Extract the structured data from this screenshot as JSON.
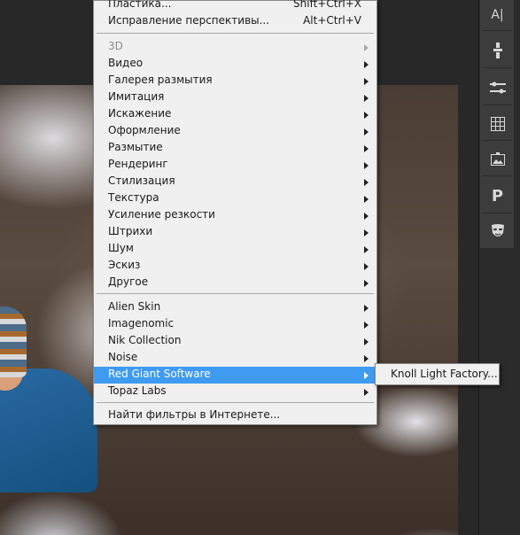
{
  "filter_menu": {
    "top_items": [
      {
        "label": "Пластика...",
        "shortcut": "Shift+Ctrl+X"
      },
      {
        "label": "Исправление перспективы...",
        "shortcut": "Alt+Ctrl+V"
      }
    ],
    "group_builtin": [
      {
        "label": "3D",
        "disabled": true
      },
      {
        "label": "Видео"
      },
      {
        "label": "Галерея размытия"
      },
      {
        "label": "Имитация"
      },
      {
        "label": "Искажение"
      },
      {
        "label": "Оформление"
      },
      {
        "label": "Размытие"
      },
      {
        "label": "Рендеринг"
      },
      {
        "label": "Стилизация"
      },
      {
        "label": "Текстура"
      },
      {
        "label": "Усиление резкости"
      },
      {
        "label": "Штрихи"
      },
      {
        "label": "Шум"
      },
      {
        "label": "Эскиз"
      },
      {
        "label": "Другое"
      }
    ],
    "group_plugins": [
      {
        "label": "Alien Skin"
      },
      {
        "label": "Imagenomic"
      },
      {
        "label": "Nik Collection"
      },
      {
        "label": "Noise"
      },
      {
        "label": "Red Giant Software",
        "highlighted": true
      },
      {
        "label": "Topaz Labs"
      }
    ],
    "bottom_item": {
      "label": "Найти фильтры в Интернете..."
    }
  },
  "submenu": {
    "items": [
      {
        "label": "Knoll Light Factory..."
      }
    ]
  },
  "side_tools": {
    "icons": [
      "character-icon",
      "brush-presets-icon",
      "adjustments-icon",
      "grid-icon",
      "image-icon",
      "paragraph-icon",
      "mask-icon"
    ],
    "glyphs": [
      "A|",
      "",
      "",
      "",
      "",
      "P",
      ""
    ]
  },
  "colors": {
    "menu_bg": "#f0f0f0",
    "highlight": "#3f9bf0",
    "workspace": "#282828"
  }
}
